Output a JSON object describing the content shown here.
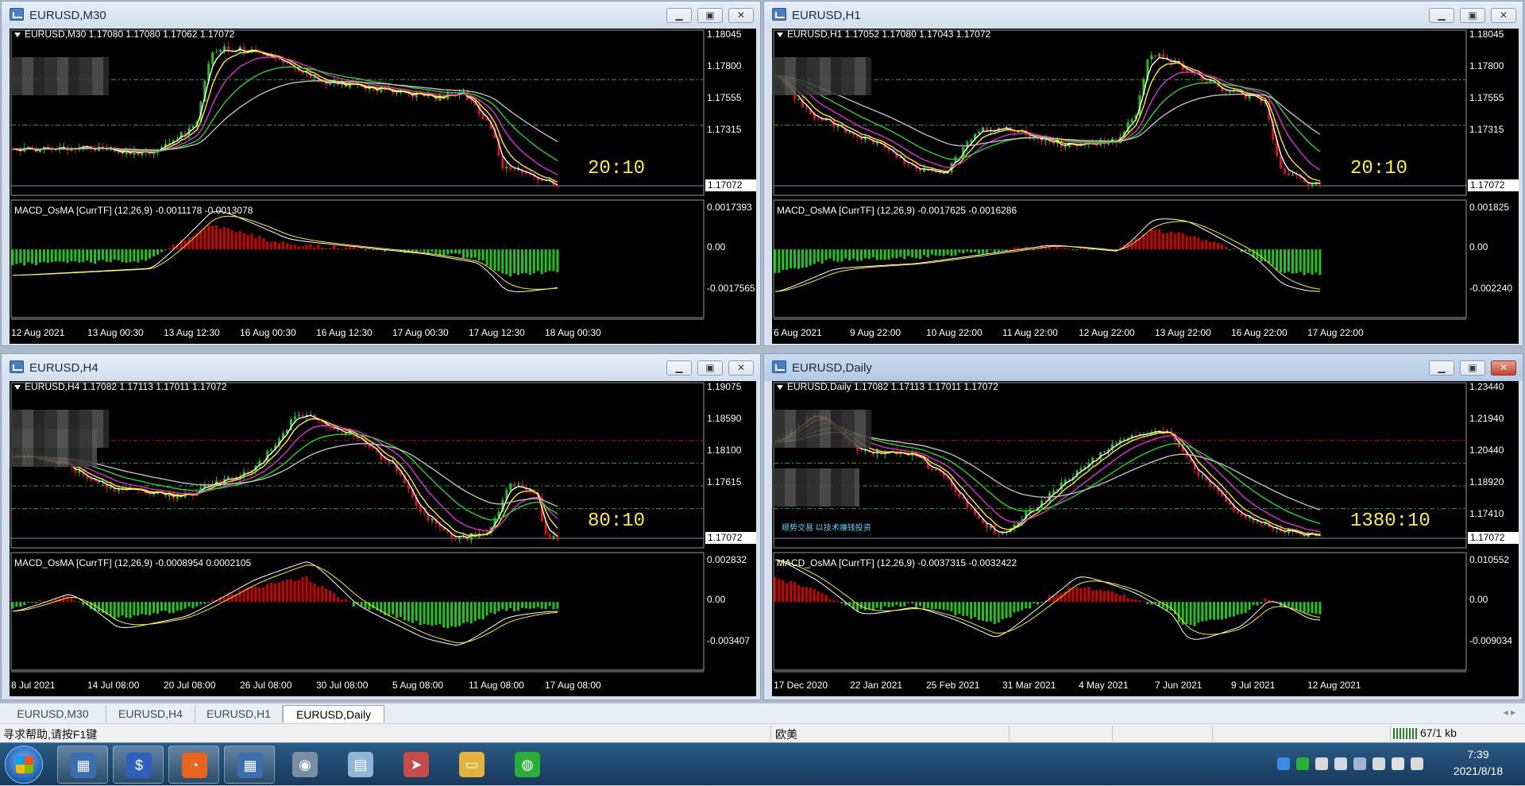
{
  "colors": {
    "bull_hist": "#d10000",
    "bear_hist": "#22c41e",
    "candle_up": "#22c41e",
    "candle_down": "#e01010",
    "ma_white": "#ffffff",
    "ma_yellow": "#ffee00",
    "ma_magenta": "#e02ad6",
    "ma_green": "#21d421",
    "ma_silver": "#bdbdbd",
    "macd_line": "#ffffff",
    "signal_line": "#ffee00"
  },
  "window_icon": "chart-window-icon",
  "windows": [
    {
      "id": "tl",
      "title": "EURUSD,M30",
      "active": false,
      "info": "EURUSD,M30  1.17080 1.17080 1.17062 1.17072",
      "scale": [
        "1.18045",
        "1.17800",
        "1.17555",
        "1.17315"
      ],
      "price": "1.17072",
      "macd_title": "MACD_OsMA [CurrTF] (12,26,9) -0.0011178 -0.0013078",
      "macd_scale": [
        "0.0017393",
        "0.00",
        "-0.0017565"
      ],
      "times": [
        "12 Aug 2021",
        "13 Aug 00:30",
        "13 Aug 12:30",
        "16 Aug 00:30",
        "16 Aug 12:30",
        "17 Aug 00:30",
        "17 Aug 12:30",
        "18 Aug 00:30"
      ],
      "timer": "20:10",
      "anno": ""
    },
    {
      "id": "tr",
      "title": "EURUSD,H1",
      "active": false,
      "info": "EURUSD,H1  1.17052 1.17080 1.17043 1.17072",
      "scale": [
        "1.18045",
        "1.17800",
        "1.17555",
        "1.17315"
      ],
      "price": "1.17072",
      "macd_title": "MACD_OsMA [CurrTF] (12,26,9) -0.0017625 -0.0016286",
      "macd_scale": [
        "0.001825",
        "0.00",
        "-0.002240"
      ],
      "times": [
        "6 Aug 2021",
        "9 Aug 22:00",
        "10 Aug 22:00",
        "11 Aug 22:00",
        "12 Aug 22:00",
        "13 Aug 22:00",
        "16 Aug 22:00",
        "17 Aug 22:00"
      ],
      "timer": "20:10",
      "anno": ""
    },
    {
      "id": "bl",
      "title": "EURUSD,H4",
      "active": false,
      "info": "EURUSD,H4  1.17082 1.17113 1.17011 1.17072",
      "scale": [
        "1.19075",
        "1.18590",
        "1.18100",
        "1.17615"
      ],
      "price": "1.17072",
      "macd_title": "MACD_OsMA [CurrTF] (12,26,9) -0.0008954 0.0002105",
      "macd_scale": [
        "0.002832",
        "0.00",
        "-0.003407"
      ],
      "times": [
        "8 Jul 2021",
        "14 Jul 08:00",
        "20 Jul 08:00",
        "26 Jul 08:00",
        "30 Jul 08:00",
        "5 Aug 08:00",
        "11 Aug 08:00",
        "17 Aug 08:00"
      ],
      "timer": "80:10",
      "anno": ""
    },
    {
      "id": "br",
      "title": "EURUSD,Daily",
      "active": true,
      "info": "EURUSD,Daily  1.17082 1.17113 1.17011 1.17072",
      "scale": [
        "1.23440",
        "1.21940",
        "1.20440",
        "1.18920",
        "1.17410"
      ],
      "price": "1.17072",
      "macd_title": "MACD_OsMA [CurrTF] (12,26,9) -0.0037315 -0.0032422",
      "macd_scale": [
        "0.010552",
        "0.00",
        "-0.009034"
      ],
      "times": [
        "17 Dec 2020",
        "22 Jan 2021",
        "25 Feb 2021",
        "31 Mar 2021",
        "4 May 2021",
        "7 Jun 2021",
        "9 Jul 2021",
        "12 Aug 2021"
      ],
      "timer": "1380:10",
      "anno": "顺势交易  以技术赚钱投资"
    }
  ],
  "tabs": [
    "EURUSD,M30",
    "EURUSD,H4",
    "EURUSD,H1",
    "EURUSD,Daily"
  ],
  "active_tab": 3,
  "tab_nav": "◂ ▸",
  "status": {
    "help": "寻求帮助,请按F1键",
    "profile": "欧美",
    "traffic": "67/1 kb"
  },
  "taskbar": {
    "apps": [
      {
        "name": "mt4-window-app",
        "glyph": "▦",
        "color": "#3b6fb0"
      },
      {
        "name": "dollar-app",
        "glyph": "$",
        "color": "#2d5fbf"
      },
      {
        "name": "orange-browser-app",
        "glyph": "◔",
        "color": "#e8641c"
      },
      {
        "name": "mt4-second-app",
        "glyph": "▦",
        "color": "#3b6fb0"
      },
      {
        "name": "camera-app",
        "glyph": "◉",
        "color": "#7a8ea3"
      },
      {
        "name": "notes-app",
        "glyph": "▤",
        "color": "#8fb6d6"
      },
      {
        "name": "pointer-app",
        "glyph": "➤",
        "color": "#c84b4b"
      },
      {
        "name": "folder-app",
        "glyph": "▭",
        "color": "#e5b33b"
      },
      {
        "name": "wechat-app",
        "glyph": "◍",
        "color": "#2aae35"
      }
    ],
    "tray_icons": [
      "shield-icon",
      "wechat-tray-icon",
      "pen-icon",
      "speaker-icon",
      "monitor-icon",
      "usb-icon",
      "mute-icon",
      "signal-icon"
    ],
    "time": "7:39",
    "date": "2021/8/18"
  }
}
